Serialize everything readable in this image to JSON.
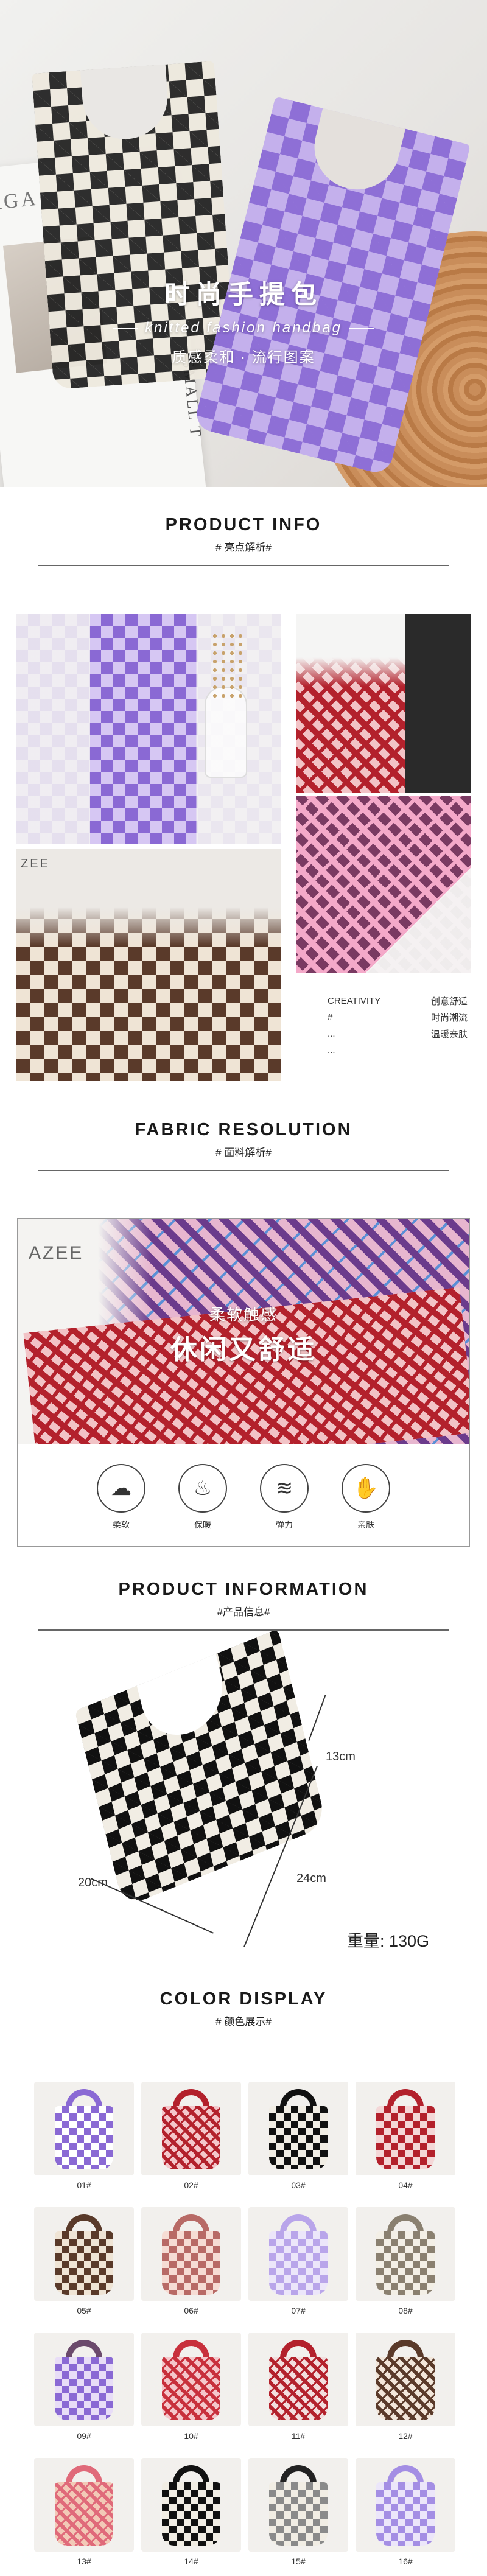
{
  "hero": {
    "title": "时尚手提包",
    "subtitle": "knitted fashion handbag",
    "tagline": "质感柔和 · 流行图案",
    "magazine_text": "AGA",
    "magazine_side": "SMALL T"
  },
  "section_info": {
    "title": "PRODUCT INFO",
    "sub": "# 亮点解析#"
  },
  "features": [
    {
      "left": "CREATIVITY",
      "right": "创意舒适"
    },
    {
      "left": "#",
      "right": "时尚潮流"
    },
    {
      "left": "...",
      "right": "温暖亲肤"
    },
    {
      "left": "...",
      "right": ""
    }
  ],
  "lifestyle_text": "ZEE",
  "section_fabric": {
    "title": "FABRIC RESOLUTION",
    "sub": "# 面料解析#"
  },
  "fabric": {
    "line1": "柔软触感",
    "line2": "休闲又舒适",
    "corner_text": "AZEE",
    "properties": [
      {
        "icon": "soft-icon",
        "glyph": "☁",
        "label": "柔软"
      },
      {
        "icon": "warm-icon",
        "glyph": "♨",
        "label": "保暖"
      },
      {
        "icon": "elastic-icon",
        "glyph": "≋",
        "label": "弹力"
      },
      {
        "icon": "skin-icon",
        "glyph": "✋",
        "label": "亲肤"
      }
    ]
  },
  "section_product": {
    "title": "PRODUCT INFORMATION",
    "sub": "#产品信息#"
  },
  "dimensions": {
    "handle": "13cm",
    "height": "24cm",
    "width": "20cm"
  },
  "weight": "重量: 130G",
  "section_color": {
    "title": "COLOR DISPLAY",
    "sub": "# 颜色展示#"
  },
  "colors": [
    {
      "label": "01#",
      "pattern": "checker",
      "a": "#ffffff",
      "b": "#8a69d4",
      "handle": "#8a69d4"
    },
    {
      "label": "02#",
      "pattern": "hound",
      "a": "#f4c7cb",
      "b": "#b3212c",
      "handle": "#b3212c"
    },
    {
      "label": "03#",
      "pattern": "checker",
      "a": "#f1ede4",
      "b": "#111111",
      "handle": "#111111"
    },
    {
      "label": "04#",
      "pattern": "checker",
      "a": "#f4d7d7",
      "b": "#b3212c",
      "handle": "#b3212c"
    },
    {
      "label": "05#",
      "pattern": "checker",
      "a": "#efe4d5",
      "b": "#5a3a2a",
      "handle": "#5a3a2a"
    },
    {
      "label": "06#",
      "pattern": "checker",
      "a": "#f6dcd4",
      "b": "#b86a66",
      "handle": "#b86a66"
    },
    {
      "label": "07#",
      "pattern": "checker",
      "a": "#ece6fa",
      "b": "#b9a5ea",
      "handle": "#b9a5ea"
    },
    {
      "label": "08#",
      "pattern": "checker",
      "a": "#f3efe6",
      "b": "#8a8070",
      "handle": "#8a8070"
    },
    {
      "label": "09#",
      "pattern": "checker",
      "a": "#e8ddf7",
      "b": "#8a69d4",
      "handle": "#6b4a6c"
    },
    {
      "label": "10#",
      "pattern": "hound",
      "a": "#f4c7cb",
      "b": "#c8303c",
      "handle": "#c8303c"
    },
    {
      "label": "11#",
      "pattern": "hound",
      "a": "#f2dede",
      "b": "#b3212c",
      "handle": "#b3212c"
    },
    {
      "label": "12#",
      "pattern": "hound",
      "a": "#f2e6da",
      "b": "#5a3a2a",
      "handle": "#5a3a2a"
    },
    {
      "label": "13#",
      "pattern": "hound",
      "a": "#f2c9b7",
      "b": "#e06a7a",
      "handle": "#e06a7a"
    },
    {
      "label": "14#",
      "pattern": "checker",
      "a": "#f1ede4",
      "b": "#111111",
      "handle": "#111111"
    },
    {
      "label": "15#",
      "pattern": "checker",
      "a": "#f1ede4",
      "b": "#8a8a8a",
      "handle": "#222222"
    },
    {
      "label": "16#",
      "pattern": "checker",
      "a": "#ece6fa",
      "b": "#a48ee4",
      "handle": "#a48ee4"
    }
  ]
}
